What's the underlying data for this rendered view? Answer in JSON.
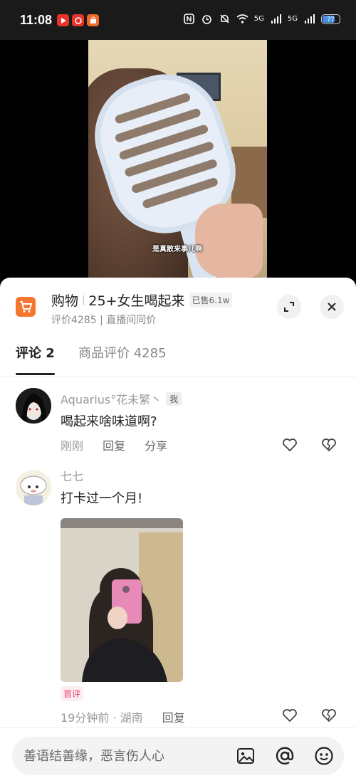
{
  "status_bar": {
    "time": "11:08",
    "network_1": "5G",
    "network_2": "5G",
    "battery": "77",
    "battery_level": 0.77,
    "icons": [
      "youtube-app-icon",
      "netease-app-icon",
      "shopping-app-icon",
      "nfc-icon",
      "alarm-icon",
      "do-not-disturb-icon",
      "wifi-icon",
      "signal-icon",
      "signal-icon"
    ]
  },
  "video": {
    "caption": "是真散来事儿啊"
  },
  "product": {
    "category": "购物",
    "title": "25+女生喝起来",
    "sold": "已售6.1w",
    "sub": "评价4285 | 直播间同价"
  },
  "tabs": {
    "comments": "评论 2",
    "reviews": "商品评价 4285"
  },
  "comments": [
    {
      "name": "Aquarius°花未繁丶",
      "tag": "我",
      "text": "喝起来啥味道啊?",
      "time": "刚刚",
      "reply": "回复",
      "share": "分享"
    },
    {
      "name": "七七",
      "text": "打卡过一个月!",
      "badge": "首评",
      "time": "19分钟前 · 湖南",
      "reply": "回复"
    }
  ],
  "input": {
    "placeholder": "善语结善缘，恶言伤人心"
  },
  "colors": {
    "accent": "#f5762e",
    "first_tag": "#e0466b",
    "battery": "#4a90e2"
  }
}
